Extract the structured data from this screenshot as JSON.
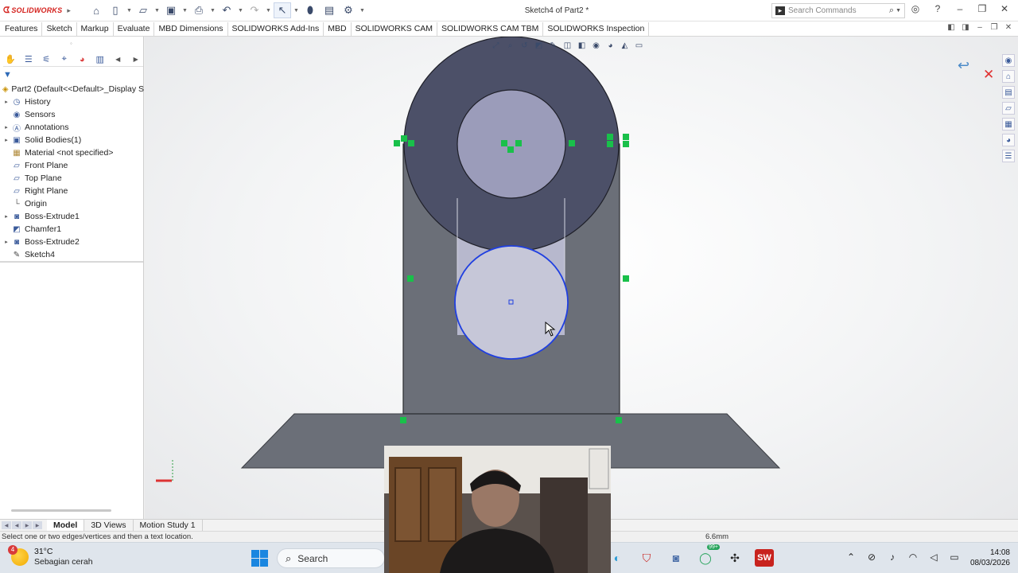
{
  "app": {
    "logo_text": "SOLIDWORKS",
    "document_title": "Sketch4 of Part2 *",
    "search_commands_placeholder": "Search Commands"
  },
  "command_tabs": [
    "Features",
    "Sketch",
    "Markup",
    "Evaluate",
    "MBD Dimensions",
    "SOLIDWORKS Add-Ins",
    "MBD",
    "SOLIDWORKS CAM",
    "SOLIDWORKS CAM TBM",
    "SOLIDWORKS Inspection"
  ],
  "feature_tree": {
    "root": "Part2  (Default<<Default>_Display S",
    "items": [
      {
        "label": "History",
        "icon": "history-icon",
        "expand": true
      },
      {
        "label": "Sensors",
        "icon": "sensors-icon",
        "expand": false
      },
      {
        "label": "Annotations",
        "icon": "annotations-icon",
        "expand": true
      },
      {
        "label": "Solid Bodies(1)",
        "icon": "solid-bodies-icon",
        "expand": true
      },
      {
        "label": "Material <not specified>",
        "icon": "material-icon",
        "expand": false
      },
      {
        "label": "Front Plane",
        "icon": "plane-icon",
        "expand": false
      },
      {
        "label": "Top Plane",
        "icon": "plane-icon",
        "expand": false
      },
      {
        "label": "Right Plane",
        "icon": "plane-icon",
        "expand": false
      },
      {
        "label": "Origin",
        "icon": "origin-icon",
        "expand": false
      },
      {
        "label": "Boss-Extrude1",
        "icon": "extrude-icon",
        "expand": true
      },
      {
        "label": "Chamfer1",
        "icon": "chamfer-icon",
        "expand": false
      },
      {
        "label": "Boss-Extrude2",
        "icon": "extrude-icon",
        "expand": true
      },
      {
        "label": "Sketch4",
        "icon": "sketch-icon",
        "expand": false
      }
    ]
  },
  "bottom_tabs": [
    "Model",
    "3D Views",
    "Motion Study 1"
  ],
  "status": {
    "message": "Select one or two edges/vertices and then a text location.",
    "measurement": "6.6mm"
  },
  "taskbar": {
    "weather_badge": "4",
    "temperature": "31°C",
    "condition": "Sebagian cerah",
    "search_placeholder": "Search",
    "whatsapp_badge": "99+",
    "solidworks_label": "SW",
    "time": "14:08",
    "date": "08/03/2026"
  },
  "colors": {
    "model_body": "#6b6f78",
    "top_disc": "#4c5068",
    "hole": "#9b9cba",
    "selected_circle": "#1f3fe0",
    "sketch_relation": "#19c04a",
    "accent_red": "#d4201c"
  }
}
